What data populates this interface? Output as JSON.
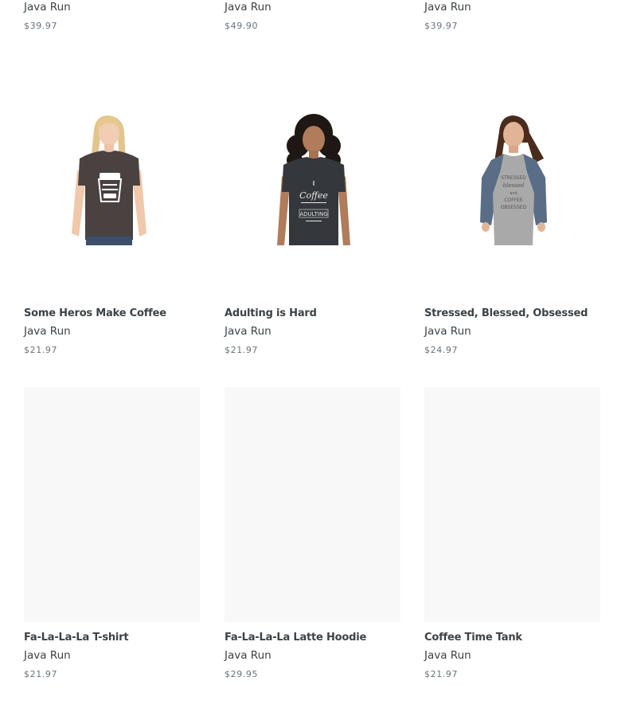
{
  "products_top_row": [
    {
      "vendor": "Java Run",
      "price": "$39.97"
    },
    {
      "vendor": "Java Run",
      "price": "$49.90"
    },
    {
      "vendor": "Java Run",
      "price": "$39.97"
    }
  ],
  "products_middle_row": [
    {
      "title": "Some Heros Make Coffee",
      "vendor": "Java Run",
      "price": "$21.97",
      "shirt_color": "#4a4240",
      "print_color": "#ffffff",
      "image_icon": "woman-brown-tshirt-image"
    },
    {
      "title": "Adulting is Hard",
      "vendor": "Java Run",
      "price": "$21.97",
      "shirt_color": "#34383d",
      "print_color": "#e8e8e8",
      "image_icon": "woman-charcoal-tshirt-image"
    },
    {
      "title": "Stressed, Blessed, Obsessed",
      "vendor": "Java Run",
      "price": "$24.97",
      "shirt_color": "#a9a9a9",
      "sleeve_color": "#5a6d87",
      "print_color": "#555555",
      "image_icon": "woman-raglan-tshirt-image"
    }
  ],
  "products_bottom_row": [
    {
      "title": "Fa-La-La-La T-shirt",
      "vendor": "Java Run",
      "price": "$21.97"
    },
    {
      "title": "Fa-La-La-La Latte Hoodie",
      "vendor": "Java Run",
      "price": "$29.95"
    },
    {
      "title": "Coffee Time Tank",
      "vendor": "Java Run",
      "price": "$21.97"
    }
  ],
  "colors": {
    "text": "#3d4246",
    "price": "#69727b",
    "placeholder": "#f8f8f8"
  }
}
